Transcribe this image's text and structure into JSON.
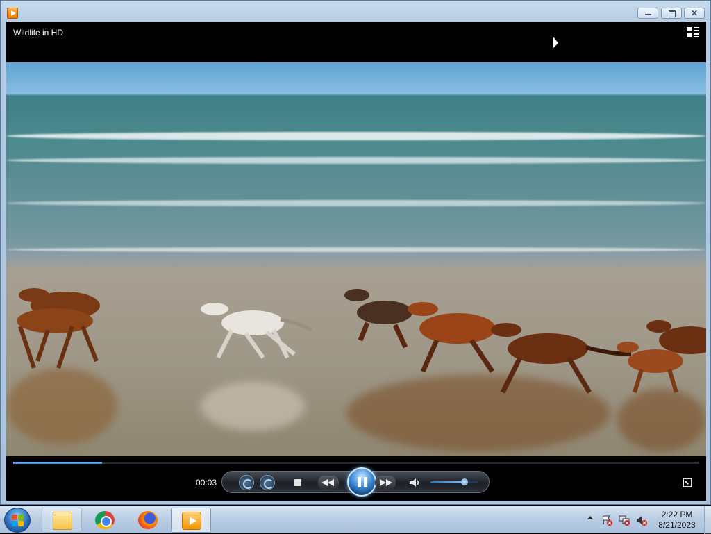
{
  "window": {
    "app_icon": "media-player-icon",
    "caption_buttons": [
      "minimize",
      "maximize",
      "close"
    ],
    "close_glyph": "✕"
  },
  "player": {
    "title": "Wildlife in HD",
    "elapsed_time": "00:03",
    "progress": 0.13,
    "volume": 0.72,
    "state": "playing",
    "accent_color": "#3f8ed8",
    "controls": [
      "shuffle",
      "repeat",
      "stop",
      "previous",
      "play-pause",
      "next",
      "mute",
      "volume",
      "fullscreen",
      "switch-to-library"
    ]
  },
  "taskbar": {
    "start_icon": "windows-logo-icon",
    "items": [
      {
        "name": "windows-explorer",
        "icon": "folder-icon"
      },
      {
        "name": "google-chrome",
        "icon": "chrome-icon"
      },
      {
        "name": "mozilla-firefox",
        "icon": "firefox-icon"
      },
      {
        "name": "windows-media-player",
        "icon": "media-player-icon",
        "active": true
      }
    ],
    "tray_icons": [
      "action-center-icon",
      "network-icon",
      "volume-icon"
    ],
    "clock_time": "2:22 PM",
    "clock_date": "8/21/2023"
  }
}
